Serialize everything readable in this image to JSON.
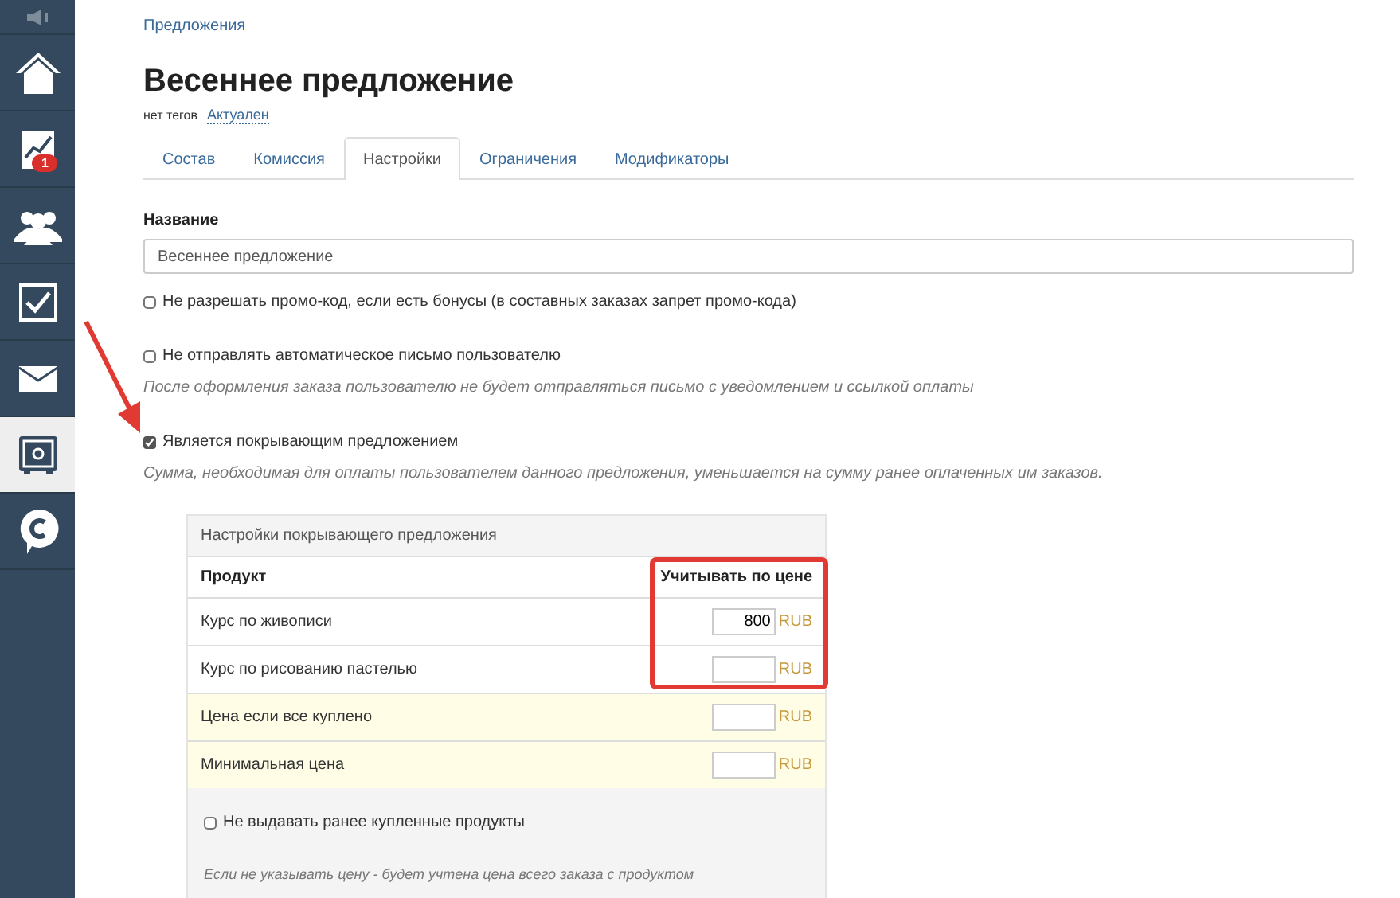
{
  "sidebar": {
    "items": [
      {
        "kind": "speaker",
        "selected": false
      },
      {
        "kind": "home",
        "selected": false
      },
      {
        "kind": "chart",
        "selected": false,
        "badge": "1"
      },
      {
        "kind": "people",
        "selected": false
      },
      {
        "kind": "task",
        "selected": false
      },
      {
        "kind": "mail",
        "selected": false
      },
      {
        "kind": "safe",
        "selected": true
      },
      {
        "kind": "chat",
        "selected": false
      }
    ]
  },
  "breadcrumb": "Предложения",
  "title": "Весеннее предложение",
  "tags": {
    "label": "нет тегов",
    "status": "Актуален"
  },
  "tabs": [
    {
      "label": "Состав",
      "selected": false
    },
    {
      "label": "Комиссия",
      "selected": false
    },
    {
      "label": "Настройки",
      "selected": true
    },
    {
      "label": "Ограничения",
      "selected": false
    },
    {
      "label": "Модификаторы",
      "selected": false
    }
  ],
  "name_field": {
    "label": "Название",
    "value": "Весеннее предложение"
  },
  "options": [
    {
      "label": "Не разрешать промо-код, если есть бонусы (в составных заказах запрет промо-кода)",
      "checked": false,
      "annotated": false
    },
    {
      "label": "Не отправлять автоматическое письмо пользователю",
      "checked": false,
      "annotated": false,
      "hint": "После оформления заказа пользователю не будет отправляться письмо с уведомлением и ссылкой оплаты"
    },
    {
      "label": "Является покрывающим предложением",
      "checked": true,
      "annotated": true,
      "hint": "Сумма, необходимая для оплаты пользователем данного предложения, уменьшается на сумму ранее оплаченных им заказов."
    }
  ],
  "panel": {
    "title": "Настройки покрывающего предложения",
    "columns": [
      {
        "label": "Продукт"
      },
      {
        "label": "Учитывать по цене",
        "highlighted": true
      }
    ],
    "rows": [
      {
        "kind": "product",
        "name": "Курс по живописи",
        "value": "800",
        "currency": "RUB"
      },
      {
        "kind": "product",
        "name": "Курс по рисованию пастелью",
        "currency": "RUB"
      },
      {
        "kind": "total",
        "name": "Цена если все куплено",
        "currency": "RUB"
      },
      {
        "kind": "total",
        "name": "Минимальная цена",
        "currency": "RUB"
      }
    ],
    "option": {
      "label": "Не выдавать ранее купленные продукты",
      "checked": false
    },
    "hint": "Если не указывать цену - будет учтена цена всего заказа с продуктом"
  }
}
